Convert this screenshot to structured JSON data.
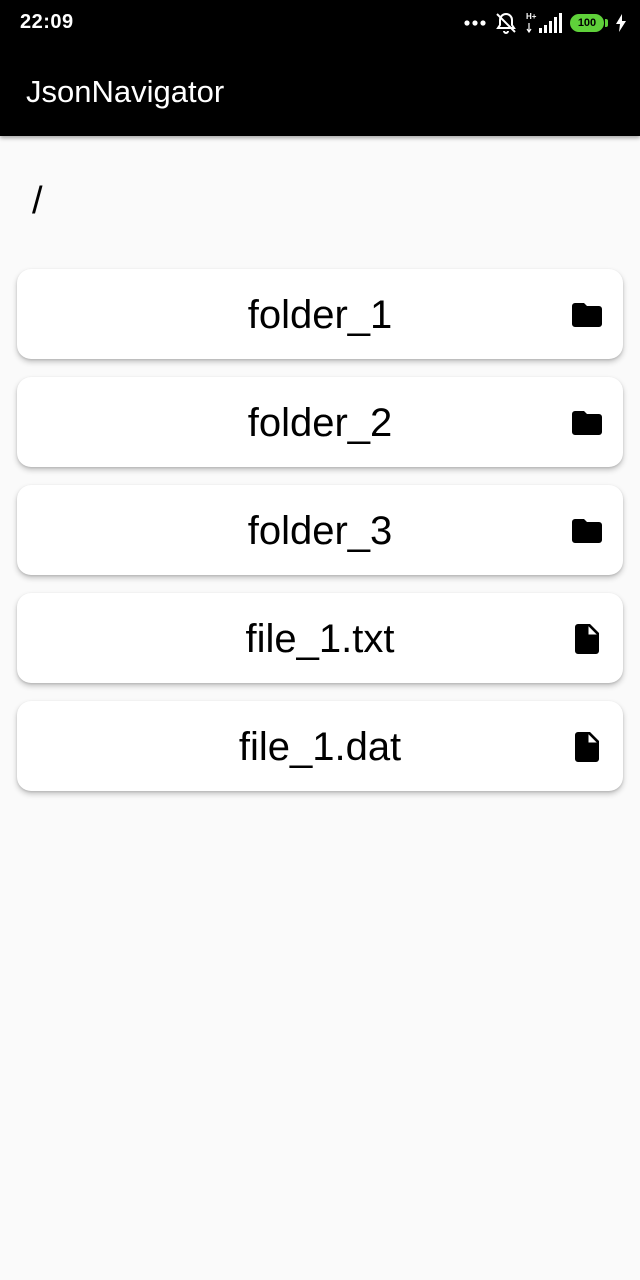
{
  "status_bar": {
    "time": "22:09",
    "battery_level": "100",
    "network_label": "H+",
    "icons": [
      "more-dots-icon",
      "silent-icon",
      "signal-icon",
      "battery-icon",
      "charging-icon"
    ]
  },
  "app_bar": {
    "title": "JsonNavigator"
  },
  "current_path": "/",
  "entries": [
    {
      "name": "folder_1",
      "icon": "folder-icon"
    },
    {
      "name": "folder_2",
      "icon": "folder-icon"
    },
    {
      "name": "folder_3",
      "icon": "folder-icon"
    },
    {
      "name": "file_1.txt",
      "icon": "file-icon"
    },
    {
      "name": "file_1.dat",
      "icon": "file-icon"
    }
  ],
  "colors": {
    "app_bar_background": "#000000",
    "page_background": "#fafafa",
    "card_background": "#ffffff",
    "battery": "#5fd13a"
  }
}
